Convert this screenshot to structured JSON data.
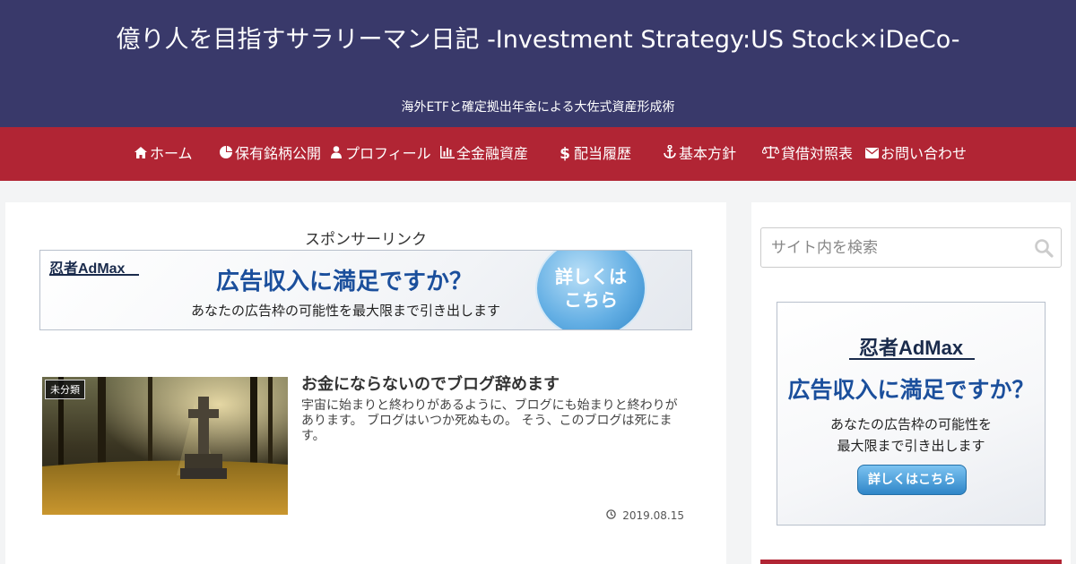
{
  "header": {
    "site_title": "億り人を目指すサラリーマン日記 -Investment Strategy:US Stock×iDeCo-",
    "tagline": "海外ETFと確定拠出年金による大佐式資産形成術"
  },
  "nav": {
    "items": [
      {
        "label": "ホーム",
        "icon": "home-icon"
      },
      {
        "label": "保有銘柄公開",
        "icon": "pie-chart-icon"
      },
      {
        "label": "プロフィール",
        "icon": "user-icon"
      },
      {
        "label": "全金融資産",
        "icon": "bar-chart-icon"
      },
      {
        "label": "配当履歴",
        "icon": "dollar-icon"
      },
      {
        "label": "基本方針",
        "icon": "anchor-icon"
      },
      {
        "label": "貸借対照表",
        "icon": "balance-scale-icon"
      },
      {
        "label": "お問い合わせ",
        "icon": "envelope-icon"
      }
    ]
  },
  "main": {
    "sponsor_label": "スポンサーリンク",
    "ad": {
      "logo": "忍者AdMax",
      "headline": "広告収入に満足ですか？",
      "sub": "あなたの広告枠の可能性を最大限まで引き出します",
      "circle_line1": "詳しくは",
      "circle_line2": "こちら"
    },
    "post": {
      "category": "未分類",
      "title": "お金にならないのでブログ辞めます",
      "excerpt": "宇宙に始まりと終わりがあるように、ブログにも始まりと終わりがあります。 ブログはいつか死ぬもの。 そう、このブログは死にます。",
      "date": "2019.08.15"
    }
  },
  "sidebar": {
    "search": {
      "placeholder": "サイト内を検索",
      "value": ""
    },
    "ad": {
      "logo": "忍者AdMax",
      "headline": "広告収入に満足ですか？",
      "sub_line1": "あなたの広告枠の可能性を",
      "sub_line2": "最大限まで引き出します",
      "button": "詳しくはこちら"
    }
  },
  "colors": {
    "header_bg": "#39396a",
    "nav_bg": "#b12534",
    "ad_blue": "#1b4f9c"
  }
}
